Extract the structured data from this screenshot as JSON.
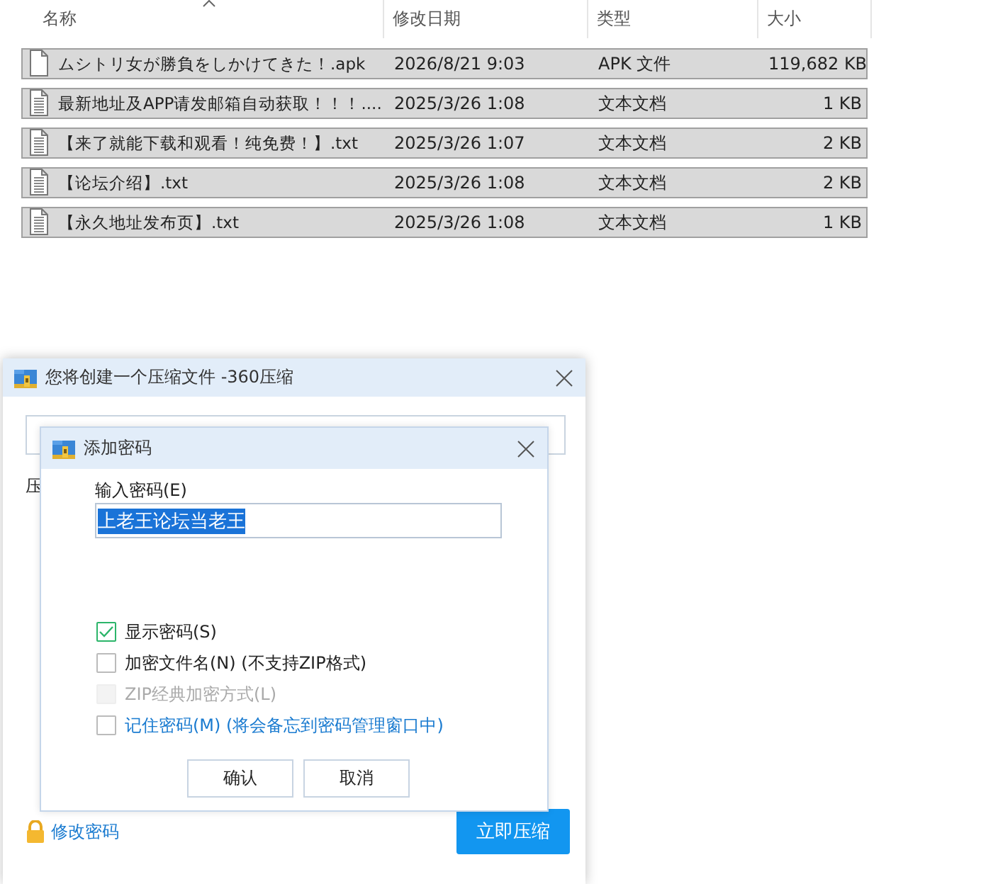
{
  "explorer": {
    "columns": [
      {
        "label": "名称",
        "sorted": true
      },
      {
        "label": "修改日期",
        "sorted": false
      },
      {
        "label": "类型",
        "sorted": false
      },
      {
        "label": "大小",
        "sorted": false
      }
    ],
    "rows": [
      {
        "kind": "apk",
        "name": "ムシトリ女が勝負をしかけてきた！.apk",
        "date": "2026/8/21 9:03",
        "type": "APK 文件",
        "size": "119,682 KB",
        "selected": true
      },
      {
        "kind": "txt",
        "name": "最新地址及APP请发邮箱自动获取！！！....",
        "date": "2025/3/26 1:08",
        "type": "文本文档",
        "size": "1 KB",
        "selected": true
      },
      {
        "kind": "txt",
        "name": "【来了就能下载和观看！纯免费！】.txt",
        "date": "2025/3/26 1:07",
        "type": "文本文档",
        "size": "2 KB",
        "selected": true
      },
      {
        "kind": "txt",
        "name": "【论坛介绍】.txt",
        "date": "2025/3/26 1:08",
        "type": "文本文档",
        "size": "2 KB",
        "selected": true
      },
      {
        "kind": "txt",
        "name": "【永久地址发布页】.txt",
        "date": "2025/3/26 1:08",
        "type": "文本文档",
        "size": "1 KB",
        "selected": true
      }
    ]
  },
  "compress_dialog": {
    "title": "您将创建一个压缩文件 -360压缩",
    "label": "压",
    "change_password_link": "修改密码",
    "compress_button": "立即压缩"
  },
  "password_dialog": {
    "title": "添加密码",
    "password_label": "输入密码(E)",
    "password_value": "上老王论坛当老王",
    "options": [
      {
        "kind": "plain",
        "label": "显示密码(S)",
        "checked": true,
        "disabled": false
      },
      {
        "kind": "plain",
        "label": "加密文件名(N) (不支持ZIP格式)",
        "checked": false,
        "disabled": false
      },
      {
        "kind": "plain",
        "label": "ZIP经典加密方式(L)",
        "checked": false,
        "disabled": true
      },
      {
        "kind": "link",
        "label": "记住密码(M) (将会备忘到密码管理窗口中)",
        "checked": false,
        "disabled": false
      }
    ],
    "buttons": [
      "确认",
      "取消"
    ]
  }
}
